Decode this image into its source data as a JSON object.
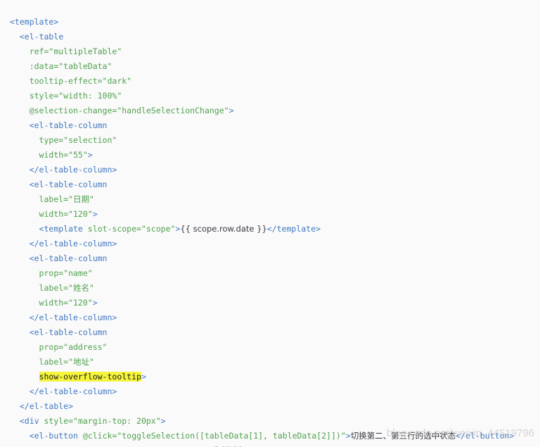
{
  "code_lines": [
    {
      "indent": 0,
      "parts": [
        [
          "tag",
          "<template>"
        ]
      ]
    },
    {
      "indent": 2,
      "parts": [
        [
          "tag",
          "<el-table"
        ]
      ]
    },
    {
      "indent": 4,
      "parts": [
        [
          "str",
          "ref=\"multipleTable\""
        ]
      ]
    },
    {
      "indent": 4,
      "parts": [
        [
          "str",
          ":data=\"tableData\""
        ]
      ]
    },
    {
      "indent": 4,
      "parts": [
        [
          "str",
          "tooltip-effect=\"dark\""
        ]
      ]
    },
    {
      "indent": 4,
      "parts": [
        [
          "str",
          "style=\"width: 100%\""
        ]
      ]
    },
    {
      "indent": 4,
      "parts": [
        [
          "str",
          "@selection-change=\"handleSelectionChange\""
        ],
        [
          "tag",
          ">"
        ]
      ]
    },
    {
      "indent": 4,
      "parts": [
        [
          "tag",
          "<el-table-column"
        ]
      ]
    },
    {
      "indent": 6,
      "parts": [
        [
          "str",
          "type=\"selection\""
        ]
      ]
    },
    {
      "indent": 6,
      "parts": [
        [
          "str",
          "width=\"55\""
        ],
        [
          "tag",
          ">"
        ]
      ]
    },
    {
      "indent": 4,
      "parts": [
        [
          "tag",
          "</el-table-column>"
        ]
      ]
    },
    {
      "indent": 4,
      "parts": [
        [
          "tag",
          "<el-table-column"
        ]
      ]
    },
    {
      "indent": 6,
      "parts": [
        [
          "str",
          "label=\"日期\""
        ]
      ]
    },
    {
      "indent": 6,
      "parts": [
        [
          "str",
          "width=\"120\""
        ],
        [
          "tag",
          ">"
        ]
      ]
    },
    {
      "indent": 6,
      "parts": [
        [
          "tag",
          "<template "
        ],
        [
          "str",
          "slot-scope=\"scope\""
        ],
        [
          "tag",
          ">"
        ],
        [
          "txt",
          "{{ scope.row.date }}"
        ],
        [
          "tag",
          "</template>"
        ]
      ]
    },
    {
      "indent": 4,
      "parts": [
        [
          "tag",
          "</el-table-column>"
        ]
      ]
    },
    {
      "indent": 4,
      "parts": [
        [
          "tag",
          "<el-table-column"
        ]
      ]
    },
    {
      "indent": 6,
      "parts": [
        [
          "str",
          "prop=\"name\""
        ]
      ]
    },
    {
      "indent": 6,
      "parts": [
        [
          "str",
          "label=\"姓名\""
        ]
      ]
    },
    {
      "indent": 6,
      "parts": [
        [
          "str",
          "width=\"120\""
        ],
        [
          "tag",
          ">"
        ]
      ]
    },
    {
      "indent": 4,
      "parts": [
        [
          "tag",
          "</el-table-column>"
        ]
      ]
    },
    {
      "indent": 4,
      "parts": [
        [
          "tag",
          "<el-table-column"
        ]
      ]
    },
    {
      "indent": 6,
      "parts": [
        [
          "str",
          "prop=\"address\""
        ]
      ]
    },
    {
      "indent": 6,
      "parts": [
        [
          "str",
          "label=\"地址\""
        ]
      ]
    },
    {
      "indent": 6,
      "parts": [
        [
          "hl",
          "show-overflow-tooltip"
        ],
        [
          "tag",
          ">"
        ]
      ]
    },
    {
      "indent": 4,
      "parts": [
        [
          "tag",
          "</el-table-column>"
        ]
      ]
    },
    {
      "indent": 2,
      "parts": [
        [
          "tag",
          "</el-table>"
        ]
      ]
    },
    {
      "indent": 2,
      "parts": [
        [
          "tag",
          "<div "
        ],
        [
          "str",
          "style=\"margin-top: 20px\""
        ],
        [
          "tag",
          ">"
        ]
      ]
    },
    {
      "indent": 4,
      "parts": [
        [
          "tag",
          "<el-button "
        ],
        [
          "str",
          "@click=\"toggleSelection([tableData[1], tableData[2]])\""
        ],
        [
          "tag",
          ">"
        ],
        [
          "txt",
          "切换第二、第三行的选中状态"
        ],
        [
          "tag",
          "</el-button>"
        ]
      ]
    },
    {
      "indent": 4,
      "parts": [
        [
          "tag",
          "<el-button "
        ],
        [
          "str",
          "@click=\"toggleSelection()\""
        ],
        [
          "tag",
          ">"
        ],
        [
          "txt",
          "取消选择"
        ],
        [
          "tag",
          "</el-button>"
        ]
      ]
    }
  ],
  "watermark": "blog.csdn.net/weixin_44519796"
}
